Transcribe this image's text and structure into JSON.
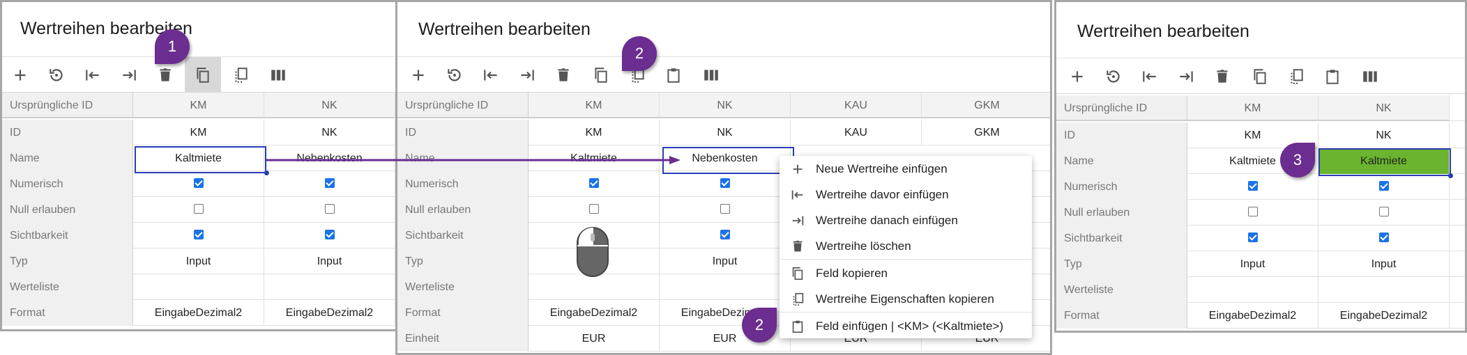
{
  "panel_title": "Wertreihen bearbeiten",
  "toolbar": [
    "plus-icon",
    "restore-icon",
    "insert-before-icon",
    "insert-after-icon",
    "trash-icon",
    "copy-field-icon",
    "copy-props-icon",
    "paste-icon",
    "columns-icon"
  ],
  "row_labels": [
    "Ursprüngliche ID",
    "ID",
    "Name",
    "Numerisch",
    "Null erlauben",
    "Sichtbarkeit",
    "Typ",
    "Werteliste",
    "Format",
    "Einheit"
  ],
  "panel1": {
    "columns": [
      {
        "header": "KM",
        "id": "KM",
        "name": "Kaltmiete",
        "numerisch": true,
        "null": false,
        "sichtbar": true,
        "typ": "Input",
        "werteliste": "",
        "format": "EingabeDezimal2"
      },
      {
        "header": "NK",
        "id": "NK",
        "name": "Nebenkosten",
        "numerisch": true,
        "null": false,
        "sichtbar": true,
        "typ": "Input",
        "werteliste": "",
        "format": "EingabeDezimal2"
      }
    ],
    "badge": "1"
  },
  "panel2": {
    "columns": [
      {
        "header": "KM",
        "id": "KM",
        "name": "Kaltmiete",
        "numerisch": true,
        "null": false,
        "sichtbar": true,
        "typ": "",
        "werteliste": "",
        "format": "EingabeDezimal2",
        "einheit": "EUR"
      },
      {
        "header": "NK",
        "id": "NK",
        "name": "Nebenkosten",
        "numerisch": true,
        "null": false,
        "sichtbar": true,
        "typ": "Input",
        "werteliste": "",
        "format": "EingabeDezimal2",
        "einheit": "EUR"
      },
      {
        "header": "KAU",
        "id": "KAU",
        "einheit": "EUR"
      },
      {
        "header": "GKM",
        "id": "GKM",
        "einheit": "EUR"
      }
    ],
    "badge_top": "2",
    "badge_bottom": "2",
    "context_menu": [
      {
        "icon": "plus-icon",
        "label": "Neue Wertreihe einfügen"
      },
      {
        "icon": "insert-before-icon",
        "label": "Wertreihe davor einfügen"
      },
      {
        "icon": "insert-after-icon",
        "label": "Wertreihe danach einfügen"
      },
      {
        "icon": "trash-icon",
        "label": "Wertreihe löschen"
      },
      {
        "icon": "copy-field-icon",
        "label": "Feld kopieren"
      },
      {
        "icon": "copy-props-icon",
        "label": "Wertreihe Eigenschaften kopieren"
      },
      {
        "icon": "paste-icon",
        "label": "Feld einfügen | <KM> (<Kaltmiete>)"
      }
    ]
  },
  "panel3": {
    "columns": [
      {
        "header": "KM",
        "id": "KM",
        "name": "Kaltmiete",
        "numerisch": true,
        "null": false,
        "sichtbar": true,
        "typ": "Input",
        "werteliste": "",
        "format": "EingabeDezimal2"
      },
      {
        "header": "NK",
        "id": "NK",
        "name": "Kaltmiete",
        "numerisch": true,
        "null": false,
        "sichtbar": true,
        "typ": "Input",
        "werteliste": "",
        "format": "EingabeDezimal2"
      }
    ],
    "badge": "3"
  },
  "colors": {
    "selection": "#2a3db5",
    "badge": "#6b2d8f",
    "checkbox": "#1a73e8",
    "pasted": "#6ab42f"
  }
}
